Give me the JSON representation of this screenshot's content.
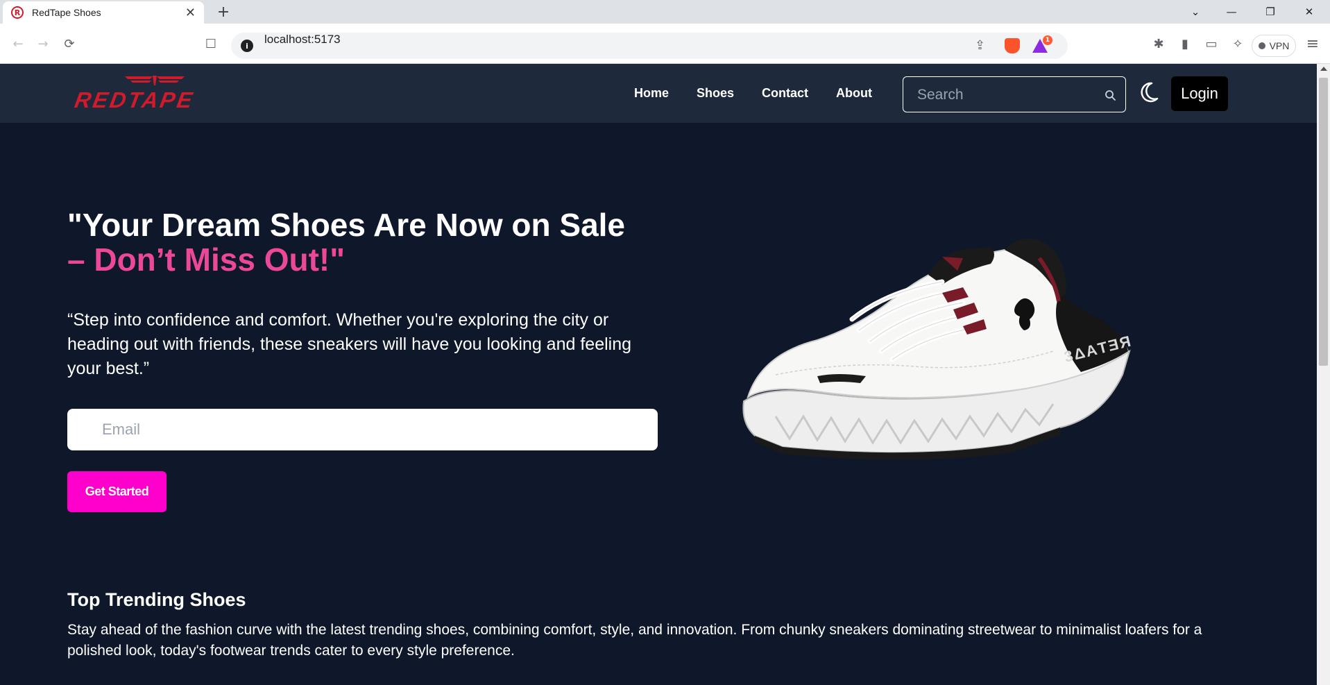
{
  "browser": {
    "tab_title": "RedTape Shoes",
    "tab_favicon": "R",
    "tab_close": "✕",
    "new_tab": "+",
    "url": "localhost:5173",
    "omnibox_info": "i",
    "rewards_badge": "1",
    "vpn_label": "VPN",
    "window_controls": {
      "dropdown": "⌄",
      "minimize": "—",
      "restore": "❐",
      "close": "✕"
    },
    "nav_icons": {
      "back": "←",
      "forward": "→",
      "reload": "⟳",
      "bookmark": "☐",
      "share": "⇪"
    },
    "toolbar_icons": {
      "extensions": "✱",
      "sidebar": "▮",
      "wallet": "▭",
      "leo": "✧",
      "menu": "≡"
    }
  },
  "site": {
    "logo_text": "REDTAPE",
    "nav": {
      "home": "Home",
      "shoes": "Shoes",
      "contact": "Contact",
      "about": "About"
    },
    "search_placeholder": "Search",
    "login_label": "Login",
    "brand_color": "#d11a2a",
    "accent_color": "#ec4899",
    "cta_color": "#ff00cc"
  },
  "hero": {
    "title_line1": "\"Your Dream Shoes Are Now on Sale",
    "title_line2": "– Don’t Miss Out!\"",
    "subtitle": "“Step into confidence and comfort. Whether you're exploring the city or heading out with friends, these sneakers will have you looking and feeling your best.”",
    "email_placeholder": "Email",
    "cta_label": "Get Started"
  },
  "trending": {
    "title": "Top Trending Shoes",
    "description": "Stay ahead of the fashion curve with the latest trending shoes, combining comfort, style, and innovation. From chunky sneakers dominating streetwear to minimalist loafers for a polished look, today's footwear trends cater to every style preference."
  },
  "icons": {
    "search": "search-icon",
    "theme": "moon-icon"
  }
}
